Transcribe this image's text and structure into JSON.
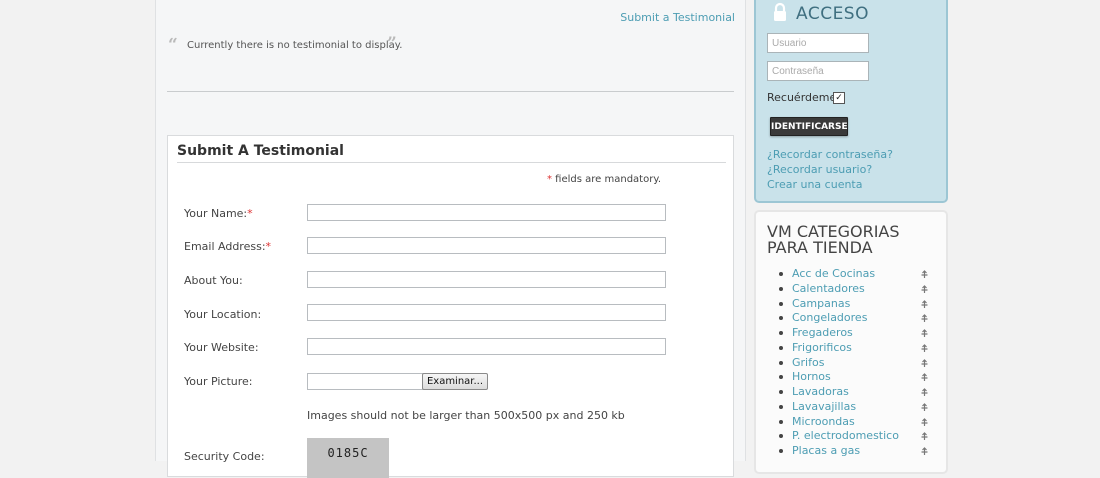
{
  "main": {
    "submit_link": "Submit a Testimonial",
    "no_testimonial": "Currently there is no testimonial to display.",
    "quote_open": "“",
    "quote_close": "”"
  },
  "form": {
    "title": "Submit A Testimonial",
    "mandatory_star": "*",
    "mandatory_text": " fields are mandatory.",
    "fields": [
      {
        "label": "Your Name:",
        "required": "*",
        "value": ""
      },
      {
        "label": "Email Address:",
        "required": "*",
        "value": ""
      },
      {
        "label": "About You:",
        "required": "",
        "value": ""
      },
      {
        "label": "Your Location:",
        "required": "",
        "value": ""
      },
      {
        "label": "Your Website:",
        "required": "",
        "value": ""
      }
    ],
    "picture_label": "Your Picture:",
    "browse_label": "Examinar...",
    "image_note": "Images should not be larger than 500x500 px and 250 kb",
    "security_label": "Security Code:",
    "captcha_text": "0185C"
  },
  "login": {
    "title": "ACCESO",
    "username_placeholder": "Usuario",
    "password_placeholder": "Contraseña",
    "remember_label": "Recuérdeme",
    "remember_checked": true,
    "login_button": "IDENTIFICARSE",
    "links": [
      "¿Recordar contraseña?",
      "¿Recordar usuario?",
      "Crear una cuenta"
    ]
  },
  "categories": {
    "title": "VM CATEGORIAS PARA TIENDA",
    "items": [
      "Acc de Cocinas",
      "Calentadores",
      "Campanas",
      "Congeladores",
      "Fregaderos",
      "Frigorificos",
      "Grifos",
      "Hornos",
      "Lavadoras",
      "Lavavajillas",
      "Microondas",
      "P. electrodomestico",
      "Placas a gas"
    ]
  },
  "colors": {
    "link": "#4d9db3",
    "required": "#dd3333",
    "login_box_bg": "#c9e2ea",
    "login_button_bg": "#3a3a3a"
  }
}
